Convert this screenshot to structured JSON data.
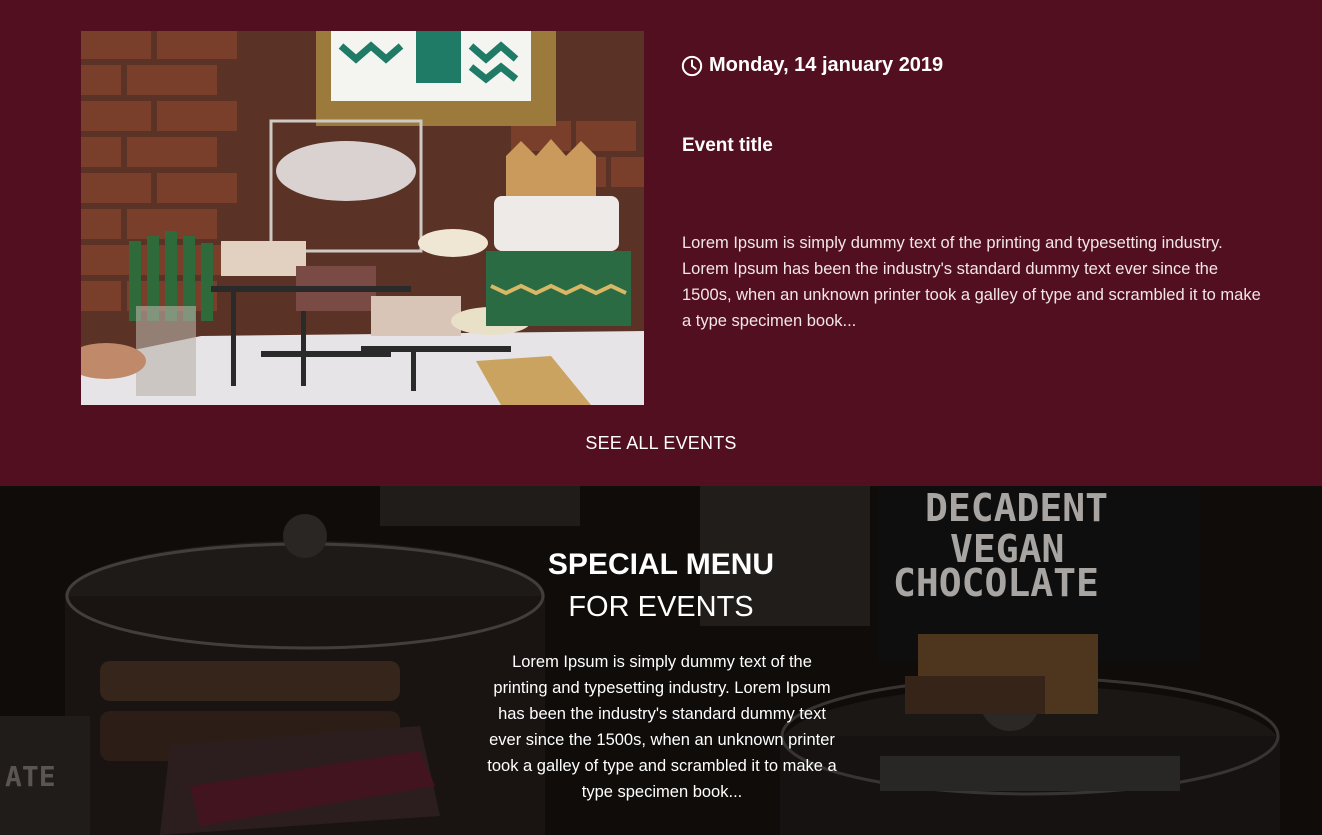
{
  "events": {
    "date": "Monday, 14 january 2019",
    "title": "Event title",
    "description": "Lorem Ipsum is simply dummy text of the printing and typesetting industry. Lorem Ipsum has been the industry's standard dummy text ever since the 1500s, when an unknown printer took a galley of type and scrambled it to make a type specimen book...",
    "see_all_label": "SEE ALL EVENTS",
    "date_icon": "clock-icon",
    "colors": {
      "section_bg": "#520f20",
      "text": "#ffffff"
    }
  },
  "special_menu": {
    "title": "SPECIAL MENU",
    "subtitle": "FOR EVENTS",
    "description": "Lorem Ipsum is simply dummy text of the printing and typesetting industry. Lorem Ipsum has been the industry's standard dummy text ever since the 1500s, when an unknown printer took a galley of type and scrambled it to make a type specimen book...",
    "sign_lines": [
      "DECADENT",
      "VEGAN",
      "CHOCOLATE"
    ]
  }
}
